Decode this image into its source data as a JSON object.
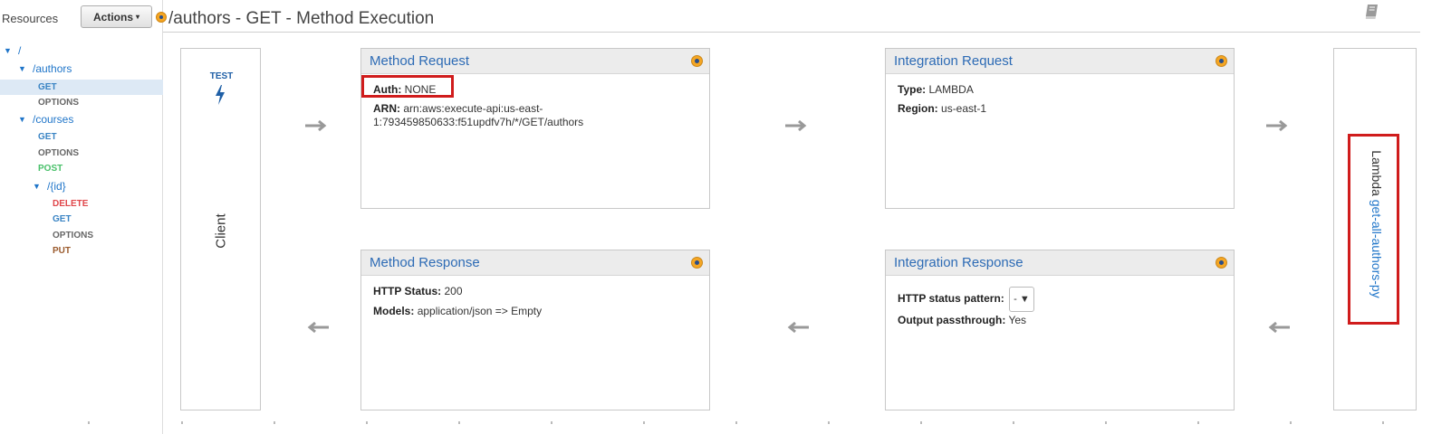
{
  "sidebar": {
    "title": "Resources",
    "actions_label": "Actions",
    "tree": {
      "root": "/",
      "authors": "/authors",
      "authors_get": "GET",
      "authors_options": "OPTIONS",
      "courses": "/courses",
      "courses_get": "GET",
      "courses_options": "OPTIONS",
      "courses_post": "POST",
      "id": "/{id}",
      "id_delete": "DELETE",
      "id_get": "GET",
      "id_options": "OPTIONS",
      "id_put": "PUT"
    }
  },
  "header": {
    "title": "/authors - GET - Method Execution"
  },
  "client": {
    "test_label": "TEST",
    "label": "Client"
  },
  "method_request": {
    "title": "Method Request",
    "auth_label": "Auth:",
    "auth_value": "NONE",
    "arn_label": "ARN:",
    "arn_line1": "arn:aws:execute-api:us-east-",
    "arn_line2": "1:793459850633:f51updfv7h/*/GET/authors"
  },
  "integration_request": {
    "title": "Integration Request",
    "type_label": "Type:",
    "type_value": "LAMBDA",
    "region_label": "Region:",
    "region_value": "us-east-1"
  },
  "method_response": {
    "title": "Method Response",
    "status_label": "HTTP Status:",
    "status_value": "200",
    "models_label": "Models:",
    "models_value": "application/json => Empty"
  },
  "integration_response": {
    "title": "Integration Response",
    "pattern_label": "HTTP status pattern:",
    "pattern_value": "-",
    "passthrough_label": "Output passthrough:",
    "passthrough_value": "Yes"
  },
  "lambda": {
    "prefix": "Lambda",
    "function_name": "get-all-authors-py"
  },
  "colors": {
    "highlight": "#d01c1c",
    "link": "#2d6bb5",
    "gear": "#f5a623"
  }
}
